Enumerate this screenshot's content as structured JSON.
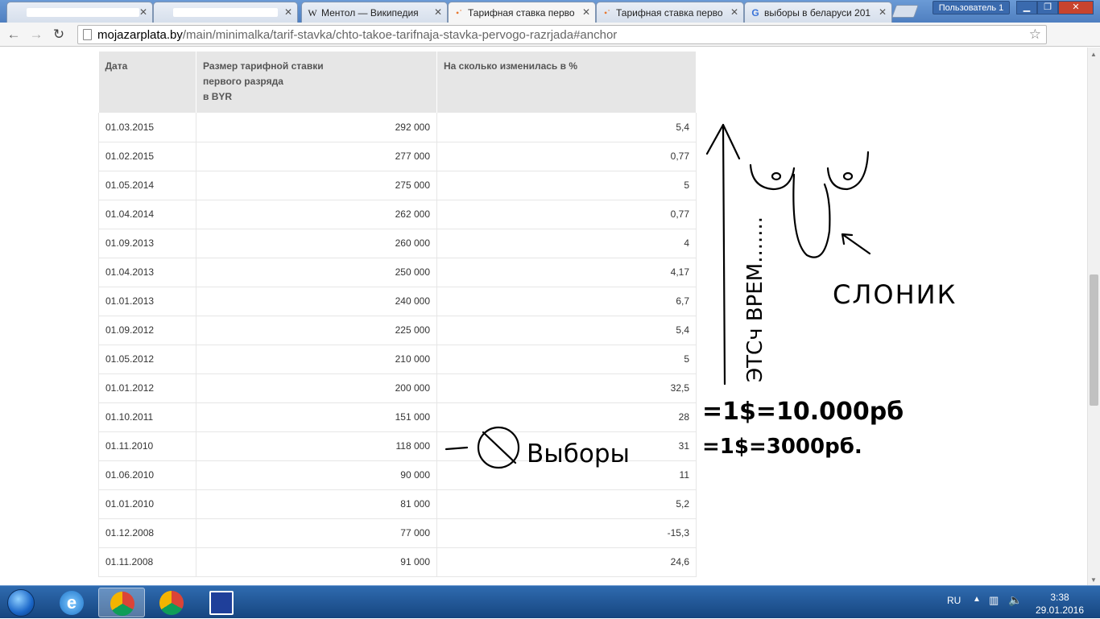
{
  "browser": {
    "tabs": [
      {
        "label": "",
        "favicon": "blank"
      },
      {
        "label": "",
        "favicon": "blank"
      },
      {
        "label": "Ментол — Википедия",
        "favicon": "W"
      },
      {
        "label": "Тарифная ставка перво",
        "favicon": "dots",
        "active": true
      },
      {
        "label": "Тарифная ставка перво",
        "favicon": "dots"
      },
      {
        "label": "выборы в беларуси 201",
        "favicon": "G"
      }
    ],
    "profile": "Пользователь 1",
    "address": {
      "host": "mojazarplata.by",
      "path": "/main/minimalka/tarif-stavka/chto-takoe-tarifnaja-stavka-pervogo-razrjada#anchor"
    }
  },
  "table": {
    "headers": [
      "Дата",
      "Размер тарифной ставки первого разряда в BYR",
      "На сколько изменилась в %"
    ],
    "header_lines": [
      [
        "Дата"
      ],
      [
        "Размер тарифной ставки",
        "первого разряда",
        "в BYR"
      ],
      [
        "На сколько изменилась в %"
      ]
    ],
    "rows": [
      [
        "01.03.2015",
        "292 000",
        "5,4"
      ],
      [
        "01.02.2015",
        "277 000",
        "0,77"
      ],
      [
        "01.05.2014",
        "275 000",
        "5"
      ],
      [
        "01.04.2014",
        "262 000",
        "0,77"
      ],
      [
        "01.09.2013",
        "260 000",
        "4"
      ],
      [
        "01.04.2013",
        "250 000",
        "4,17"
      ],
      [
        "01.01.2013",
        "240 000",
        "6,7"
      ],
      [
        "01.09.2012",
        "225 000",
        "5,4"
      ],
      [
        "01.05.2012",
        "210 000",
        "5"
      ],
      [
        "01.01.2012",
        "200 000",
        "32,5"
      ],
      [
        "01.10.2011",
        "151 000",
        "28"
      ],
      [
        "01.11.2010",
        "118 000",
        "31"
      ],
      [
        "01.06.2010",
        "90 000",
        "11"
      ],
      [
        "01.01.2010",
        "81 000",
        "5,2"
      ],
      [
        "01.12.2008",
        "77 000",
        "-15,3"
      ],
      [
        "01.11.2008",
        "91 000",
        "24,6"
      ]
    ]
  },
  "annotations": {
    "vertical": "ЭТСч ВРЕМ.......",
    "elephant": "СЛОНИК",
    "elections": "Выборы",
    "rate1": "=1$=10.000рб",
    "rate2": "=1$=3000рб."
  },
  "taskbar": {
    "language": "RU",
    "time": "3:38",
    "date": "29.01.2016"
  }
}
